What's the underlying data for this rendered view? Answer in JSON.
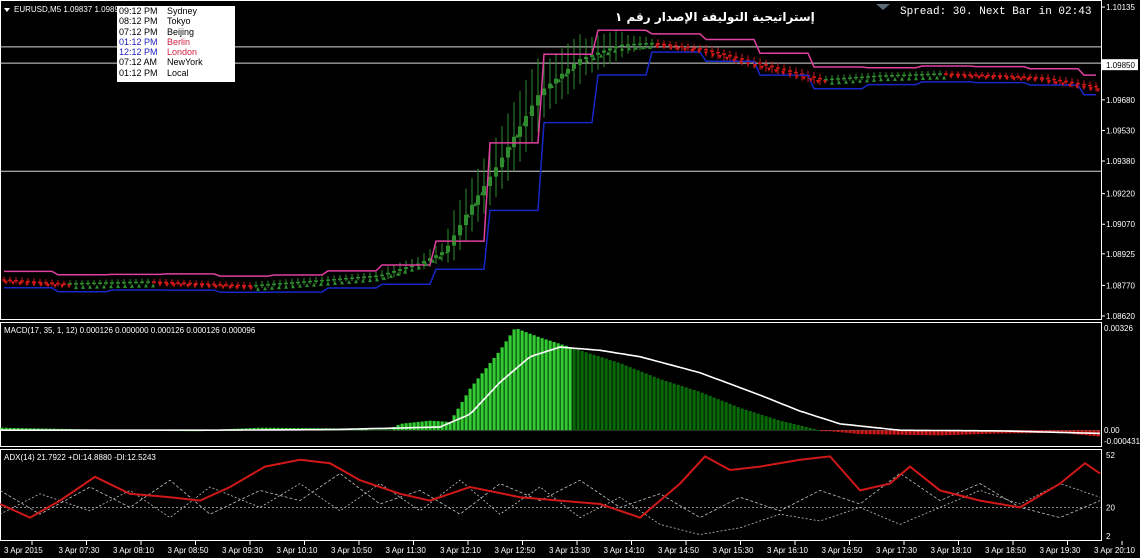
{
  "window": {
    "symbol_info": "EURUSD,M5  1.09837 1.0989",
    "spread_text": "Spread: 30. Next Bar in 02:43",
    "overlay_title": "إستراتيجية التوليفة  الإصدار رقم  ١"
  },
  "clock": [
    {
      "time": "09:12 PM",
      "city": "Sydney"
    },
    {
      "time": "08:12 PM",
      "city": "Tokyo"
    },
    {
      "time": "07:12 PM",
      "city": "Beijing"
    },
    {
      "time": "01:12 PM",
      "city": "Berlin"
    },
    {
      "time": "12:12 PM",
      "city": "London"
    },
    {
      "time": "07:12 AM",
      "city": "NewYork"
    },
    {
      "time": "01:12 PM",
      "city": "Local"
    }
  ],
  "colors": {
    "background": "#000000",
    "bull_candle": "#2e8b2e",
    "bear_candle": "#d01818",
    "upper_band": "#e040a0",
    "lower_band": "#1828c8",
    "macd_hist_bright": "#32cd32",
    "macd_hist_dark": "#0a6a0a",
    "macd_signal": "#ffffff",
    "adx_main": "#d01818",
    "adx_di": "#c0c0c0"
  },
  "chart_data": [
    {
      "type": "candlestick",
      "title": "EURUSD,M5",
      "y_ticks": [
        "1.10135",
        "1.09850",
        "1.09530",
        "1.09280",
        "1.08905",
        "1.08620"
      ],
      "right_labels": [
        "1.10135",
        "1.09850",
        "1.09680",
        "1.09530",
        "1.09380",
        "1.09220",
        "1.09070",
        "1.08925",
        "1.08770",
        "1.08620"
      ],
      "current_price_label": "1.09850",
      "levels": [
        1.0994,
        1.0986,
        1.0933
      ],
      "ylim": [
        1.0862,
        1.1015
      ],
      "trend_close": [
        [
          0,
          1.088
        ],
        [
          60,
          1.0878
        ],
        [
          150,
          1.0879
        ],
        [
          250,
          1.0877
        ],
        [
          330,
          1.088
        ],
        [
          380,
          1.0882
        ],
        [
          420,
          1.0888
        ],
        [
          445,
          1.0894
        ],
        [
          470,
          1.0915
        ],
        [
          500,
          1.0938
        ],
        [
          520,
          1.0955
        ],
        [
          540,
          1.0972
        ],
        [
          580,
          1.0988
        ],
        [
          620,
          1.0995
        ],
        [
          650,
          1.0996
        ],
        [
          700,
          1.0993
        ],
        [
          740,
          1.0988
        ],
        [
          780,
          1.0983
        ],
        [
          820,
          1.0978
        ],
        [
          880,
          1.098
        ],
        [
          940,
          1.0981
        ],
        [
          1000,
          1.098
        ],
        [
          1040,
          1.0979
        ],
        [
          1100,
          1.0974
        ]
      ]
    },
    {
      "type": "bar",
      "title": "MACD(17, 35, 1, 12) 0.000126 0.000000 0.000126 0.000126 0.000096",
      "y_ticks": [
        "0.00326",
        "0.00",
        "-0.000431"
      ],
      "ylim": [
        -0.00043,
        0.00326
      ],
      "hist": [
        [
          0,
          8e-05
        ],
        [
          100,
          2e-05
        ],
        [
          200,
          0.0
        ],
        [
          260,
          8e-05
        ],
        [
          330,
          6e-05
        ],
        [
          390,
          4e-05
        ],
        [
          400,
          0.0002
        ],
        [
          430,
          0.0003
        ],
        [
          450,
          0.00026
        ],
        [
          470,
          0.0013
        ],
        [
          500,
          0.0025
        ],
        [
          515,
          0.0032
        ],
        [
          540,
          0.0029
        ],
        [
          580,
          0.0025
        ],
        [
          620,
          0.0021
        ],
        [
          660,
          0.0016
        ],
        [
          700,
          0.0012
        ],
        [
          740,
          0.0007
        ],
        [
          780,
          0.0003
        ],
        [
          820,
          0.0
        ],
        [
          860,
          -0.00012
        ],
        [
          940,
          -0.00016
        ],
        [
          1000,
          -0.0001
        ],
        [
          1060,
          -8e-05
        ],
        [
          1100,
          -0.0002
        ]
      ],
      "signal": [
        [
          0,
          0.0
        ],
        [
          200,
          0.0
        ],
        [
          330,
          2e-05
        ],
        [
          440,
          0.0001
        ],
        [
          470,
          0.0005
        ],
        [
          500,
          0.0015
        ],
        [
          530,
          0.0023
        ],
        [
          560,
          0.0026
        ],
        [
          600,
          0.0025
        ],
        [
          640,
          0.0023
        ],
        [
          700,
          0.0018
        ],
        [
          760,
          0.0011
        ],
        [
          800,
          0.0006
        ],
        [
          840,
          0.0002
        ],
        [
          900,
          0.0
        ],
        [
          1000,
          -2e-05
        ],
        [
          1100,
          -0.0001
        ]
      ]
    },
    {
      "type": "line",
      "title": "ADX(14) 21.7922 +DI:14.8880 -DI:12.5243",
      "y_ticks": [
        "52",
        "20",
        "2"
      ],
      "ylim": [
        2,
        52
      ],
      "adx": [
        [
          0,
          22
        ],
        [
          30,
          14
        ],
        [
          60,
          24
        ],
        [
          95,
          38
        ],
        [
          130,
          28
        ],
        [
          170,
          26
        ],
        [
          200,
          24
        ],
        [
          230,
          32
        ],
        [
          265,
          44
        ],
        [
          300,
          48
        ],
        [
          330,
          46
        ],
        [
          360,
          36
        ],
        [
          400,
          28
        ],
        [
          430,
          24
        ],
        [
          470,
          32
        ],
        [
          520,
          26
        ],
        [
          560,
          24
        ],
        [
          600,
          22
        ],
        [
          640,
          14
        ],
        [
          680,
          34
        ],
        [
          705,
          50
        ],
        [
          730,
          42
        ],
        [
          760,
          44
        ],
        [
          800,
          48
        ],
        [
          830,
          50
        ],
        [
          860,
          30
        ],
        [
          890,
          34
        ],
        [
          910,
          44
        ],
        [
          940,
          30
        ],
        [
          980,
          24
        ],
        [
          1020,
          20
        ],
        [
          1060,
          34
        ],
        [
          1085,
          46
        ],
        [
          1100,
          40
        ]
      ],
      "di_plus": [
        [
          0,
          30
        ],
        [
          40,
          16
        ],
        [
          90,
          32
        ],
        [
          130,
          20
        ],
        [
          170,
          36
        ],
        [
          210,
          16
        ],
        [
          260,
          30
        ],
        [
          300,
          24
        ],
        [
          340,
          40
        ],
        [
          380,
          22
        ],
        [
          420,
          30
        ],
        [
          460,
          16
        ],
        [
          500,
          34
        ],
        [
          540,
          24
        ],
        [
          580,
          36
        ],
        [
          620,
          20
        ],
        [
          660,
          28
        ],
        [
          700,
          14
        ],
        [
          740,
          26
        ],
        [
          780,
          18
        ],
        [
          820,
          30
        ],
        [
          860,
          22
        ],
        [
          900,
          40
        ],
        [
          940,
          24
        ],
        [
          980,
          34
        ],
        [
          1020,
          20
        ],
        [
          1060,
          14
        ],
        [
          1100,
          24
        ]
      ],
      "di_minus": [
        [
          0,
          16
        ],
        [
          40,
          28
        ],
        [
          90,
          18
        ],
        [
          130,
          30
        ],
        [
          170,
          14
        ],
        [
          210,
          32
        ],
        [
          260,
          20
        ],
        [
          300,
          34
        ],
        [
          340,
          18
        ],
        [
          380,
          34
        ],
        [
          420,
          18
        ],
        [
          460,
          36
        ],
        [
          500,
          16
        ],
        [
          540,
          32
        ],
        [
          580,
          14
        ],
        [
          620,
          26
        ],
        [
          660,
          10
        ],
        [
          700,
          4
        ],
        [
          740,
          8
        ],
        [
          780,
          16
        ],
        [
          820,
          12
        ],
        [
          860,
          20
        ],
        [
          900,
          10
        ],
        [
          940,
          20
        ],
        [
          980,
          30
        ],
        [
          1020,
          22
        ],
        [
          1060,
          34
        ],
        [
          1100,
          26
        ]
      ]
    }
  ],
  "x_axis": {
    "tick_labels": [
      "3 Apr 2015",
      "3 Apr 07:30",
      "3 Apr 08:10",
      "3 Apr 08:50",
      "3 Apr 09:30",
      "3 Apr 10:10",
      "3 Apr 10:50",
      "3 Apr 11:30",
      "3 Apr 12:10",
      "3 Apr 12:50",
      "3 Apr 13:30",
      "3 Apr 14:10",
      "3 Apr 14:50",
      "3 Apr 15:30",
      "3 Apr 16:10",
      "3 Apr 16:50",
      "3 Apr 17:30",
      "3 Apr 18:10",
      "3 Apr 18:50",
      "3 Apr 19:30",
      "3 Apr 20:10"
    ]
  }
}
